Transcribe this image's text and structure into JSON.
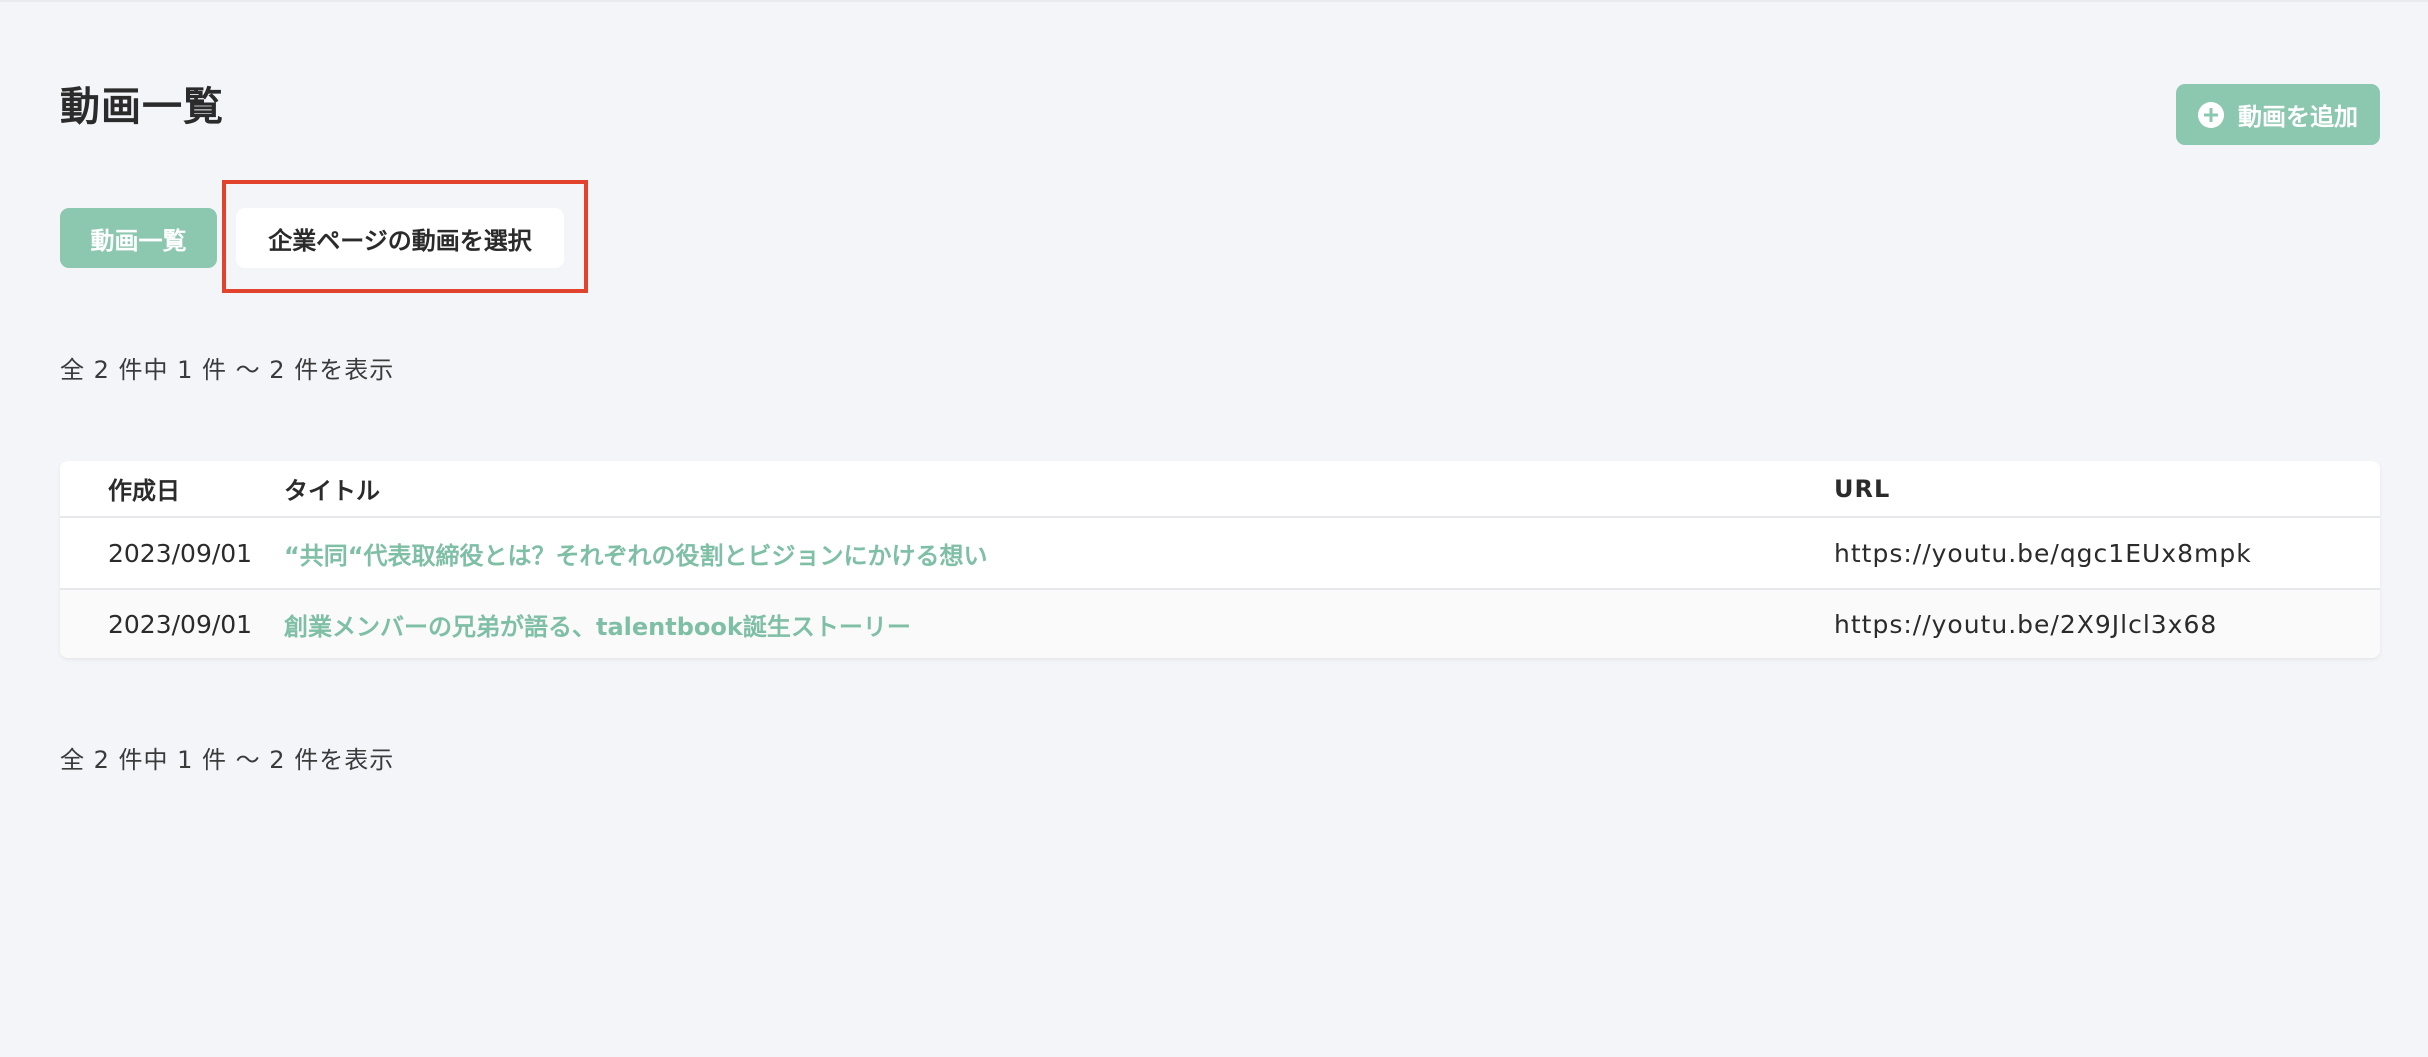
{
  "header": {
    "title": "動画一覧",
    "add_button_label": "動画を追加"
  },
  "tabs": [
    {
      "label": "動画一覧",
      "active": true
    },
    {
      "label": "企業ページの動画を選択",
      "active": false
    }
  ],
  "count_text": "全 2 件中 1 件 〜 2 件を表示",
  "table": {
    "headers": {
      "date": "作成日",
      "title": "タイトル",
      "url": "URL"
    },
    "rows": [
      {
        "date": "2023/09/01",
        "title": "“共同“代表取締役とは？それぞれの役割とビジョンにかける想い",
        "url": "https://youtu.be/qgc1EUx8mpk"
      },
      {
        "date": "2023/09/01",
        "title": "創業メンバーの兄弟が語る、talentbook誕生ストーリー",
        "url": "https://youtu.be/2X9Jlcl3x68"
      }
    ]
  },
  "colors": {
    "accent": "#8cc7b0",
    "link": "#7fbfa6",
    "highlight": "#e2432c",
    "background": "#f4f5f9"
  }
}
